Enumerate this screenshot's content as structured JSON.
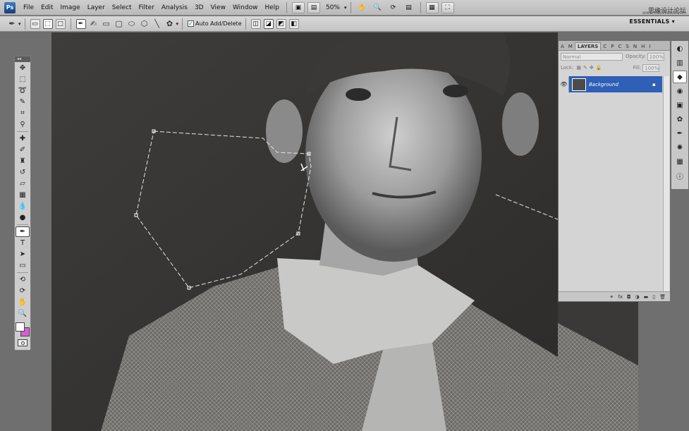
{
  "app": {
    "logo": "Ps",
    "workspace_label": "ESSENTIALS ▾"
  },
  "menu": [
    "File",
    "Edit",
    "Image",
    "Layer",
    "Select",
    "Filter",
    "Analysis",
    "3D",
    "View",
    "Window",
    "Help"
  ],
  "menubar": {
    "zoom": "50%"
  },
  "watermark": {
    "line1": "思缘设计论坛",
    "line2": "www.MISSYUAN.com"
  },
  "options": {
    "auto_add_delete_label": "Auto Add/Delete",
    "auto_add_delete_checked": true
  },
  "tools_header": "◂◂",
  "tools": [
    {
      "icon": "move-icon",
      "glyph": "✥"
    },
    {
      "icon": "marquee-icon",
      "glyph": "⬚"
    },
    {
      "icon": "lasso-icon",
      "glyph": "➰"
    },
    {
      "icon": "quick-selection-icon",
      "glyph": "✎"
    },
    {
      "icon": "crop-icon",
      "glyph": "⌗"
    },
    {
      "icon": "eyedropper-icon",
      "glyph": "⚲"
    },
    {
      "icon": "healing-brush-icon",
      "glyph": "✚"
    },
    {
      "icon": "brush-icon",
      "glyph": "✐"
    },
    {
      "icon": "clone-stamp-icon",
      "glyph": "♜"
    },
    {
      "icon": "history-brush-icon",
      "glyph": "↺"
    },
    {
      "icon": "eraser-icon",
      "glyph": "▱"
    },
    {
      "icon": "gradient-icon",
      "glyph": "▦"
    },
    {
      "icon": "blur-icon",
      "glyph": "💧"
    },
    {
      "icon": "dodge-icon",
      "glyph": "●"
    },
    {
      "icon": "pen-icon",
      "glyph": "✒"
    },
    {
      "icon": "type-icon",
      "glyph": "T"
    },
    {
      "icon": "path-selection-icon",
      "glyph": "➤"
    },
    {
      "icon": "shape-icon",
      "glyph": "▭"
    },
    {
      "icon": "3d-rotate-icon",
      "glyph": "⟲"
    },
    {
      "icon": "3d-orbit-icon",
      "glyph": "⟳"
    },
    {
      "icon": "hand-icon",
      "glyph": "✋"
    },
    {
      "icon": "zoom-icon",
      "glyph": "🔍"
    }
  ],
  "layers_panel": {
    "tabs": [
      "A",
      "M",
      "LAYERS",
      "C",
      "P",
      "C",
      "S",
      "N",
      "H",
      "I"
    ],
    "active_tab": "LAYERS",
    "blend_mode": "Normal",
    "opacity_label": "Opacity:",
    "opacity_value": "100%",
    "lock_label": "Lock:",
    "fill_label": "Fill:",
    "fill_value": "100%",
    "layers": [
      {
        "name": "Background",
        "locked": true,
        "visible": true
      }
    ]
  },
  "dock_icons": [
    "navigator-icon",
    "histogram-icon",
    "layers-icon",
    "adjustments-icon",
    "masks-icon",
    "styles-icon",
    "paths-icon",
    "brush-presets-icon",
    "swatches-icon",
    "info-icon"
  ],
  "colors": {
    "foreground": "#ffffff",
    "background": "#d85ed4",
    "selection_accent": "#2f5fb6"
  }
}
